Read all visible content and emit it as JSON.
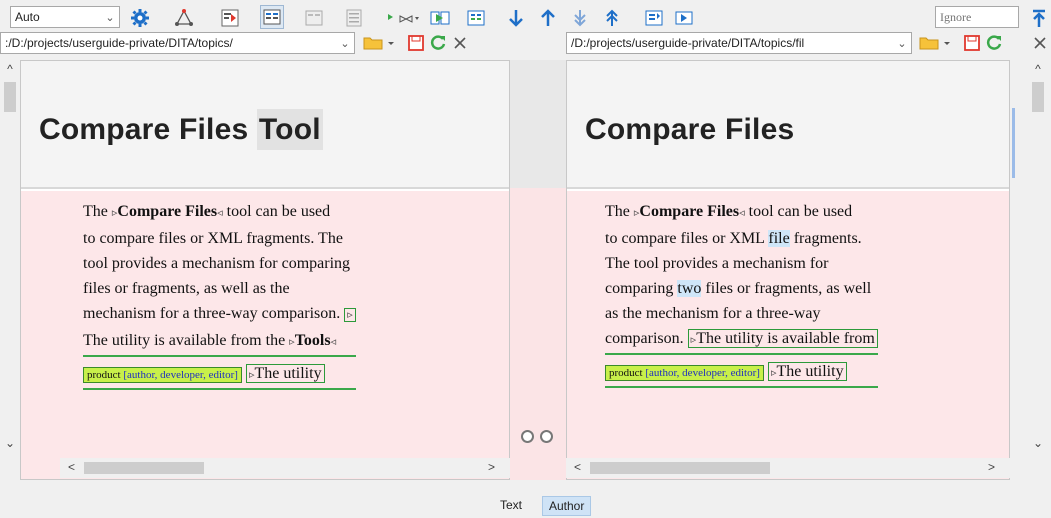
{
  "toolbar": {
    "level_combo": "Auto",
    "ignore_placeholder": "Ignore",
    "icons": [
      "settings-icon",
      "hierarchy-icon",
      "show-diff-icon",
      "pressed-view-icon",
      "view-icon",
      "text-view-icon",
      "merge-icon",
      "copy-left-icon",
      "copy-all-icon",
      "next-diff-icon",
      "prev-diff-icon",
      "last-change-icon",
      "first-change-icon",
      "sync-scroll-icon",
      "copy-right-icon",
      "top-icon"
    ]
  },
  "left": {
    "path": ":/D:/projects/userguide-private/DITA/topics/",
    "title_a": "Compare Files ",
    "title_b": "Tool",
    "lines": [
      {
        "pre": "The ",
        "m1": "▹",
        "bold": "Compare Files",
        "m2": "◃",
        "post": " tool can be used"
      },
      {
        "text": "to compare files or XML fragments. The"
      },
      {
        "text": "tool provides a mechanism for comparing"
      },
      {
        "text": "files or fragments, as well as the"
      },
      {
        "text": "mechanism for a three-way comparison.",
        "marker": "▹"
      },
      {
        "pre": "The utility is available from the ",
        "m1": "▹",
        "bold": "Tools",
        "m2": "◃"
      }
    ],
    "prod": {
      "name": "product",
      "attrs": "[author, developer, editor]"
    },
    "trailing": "The utility"
  },
  "right": {
    "path": "/D:/projects/userguide-private/DITA/topics/fil",
    "title": "Compare Files",
    "lines": [
      {
        "pre": "The ",
        "m1": "▹",
        "bold": "Compare Files",
        "m2": "◃",
        "post": " tool can be used"
      },
      {
        "pre": "to compare files or XML ",
        "hl": "file",
        "post": " fragments."
      },
      {
        "text": "The tool provides a mechanism for"
      },
      {
        "pre": "comparing ",
        "hl": "two",
        "post": " files or fragments, as well"
      },
      {
        "text": "as the mechanism for a three-way"
      },
      {
        "pre": "comparison.",
        "boxed": "The utility is available from"
      }
    ],
    "prod": {
      "name": "product",
      "attrs": "[author, developer, editor]"
    },
    "trailing": "The utility"
  },
  "tabs": {
    "text": "Text",
    "author": "Author"
  },
  "colors": {
    "accent": "#1e6fc8",
    "green": "#2c9a3a",
    "diff_bg": "#fde7e9"
  }
}
